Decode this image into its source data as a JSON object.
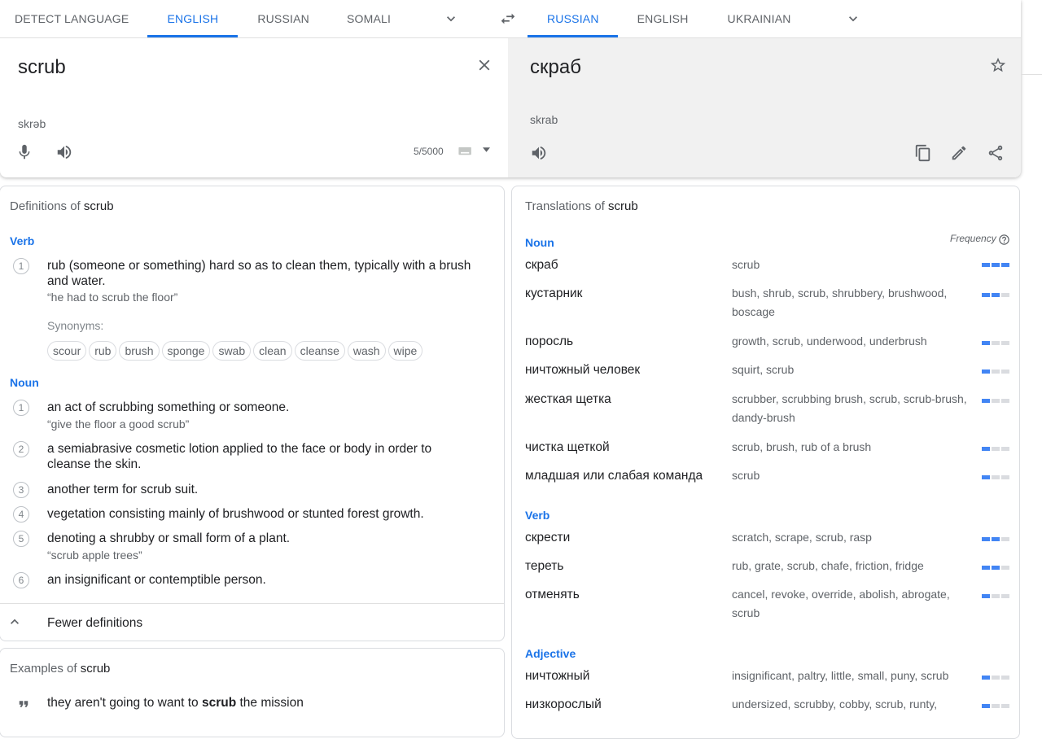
{
  "source_langs": {
    "tabs": [
      {
        "label": "DETECT LANGUAGE",
        "active": false
      },
      {
        "label": "ENGLISH",
        "active": true
      },
      {
        "label": "RUSSIAN",
        "active": false
      },
      {
        "label": "SOMALI",
        "active": false
      }
    ]
  },
  "target_langs": {
    "tabs": [
      {
        "label": "RUSSIAN",
        "active": true
      },
      {
        "label": "ENGLISH",
        "active": false
      },
      {
        "label": "UKRAINIAN",
        "active": false
      }
    ]
  },
  "source": {
    "text": "scrub",
    "transliteration": "skrəb",
    "char_count": "5/5000"
  },
  "target": {
    "text": "скраб",
    "transliteration": "skrab"
  },
  "icons": {
    "accent": "#1a73e8",
    "freq_on": "#4285f4",
    "freq_off": "#dadce0"
  },
  "definitions": {
    "title_prefix": "Definitions of",
    "title_word": "scrub",
    "verb_label": "Verb",
    "verb": [
      {
        "num": "1",
        "text": "rub (someone or something) hard so as to clean them, typically with a brush and water.",
        "example": "“he had to scrub the floor”"
      }
    ],
    "synonyms_label": "Synonyms:",
    "synonyms": [
      "scour",
      "rub",
      "brush",
      "sponge",
      "swab",
      "clean",
      "cleanse",
      "wash",
      "wipe"
    ],
    "noun_label": "Noun",
    "noun": [
      {
        "num": "1",
        "text": "an act of scrubbing something or someone.",
        "example": "“give the floor a good scrub”"
      },
      {
        "num": "2",
        "text": "a semiabrasive cosmetic lotion applied to the face or body in order to cleanse the skin.",
        "example": ""
      },
      {
        "num": "3",
        "text": "another term for scrub suit.",
        "example": ""
      },
      {
        "num": "4",
        "text": "vegetation consisting mainly of brushwood or stunted forest growth.",
        "example": ""
      },
      {
        "num": "5",
        "text": "denoting a shrubby or small form of a plant.",
        "example": "“scrub apple trees”"
      },
      {
        "num": "6",
        "text": "an insignificant or contemptible person.",
        "example": ""
      }
    ],
    "fewer_label": "Fewer definitions"
  },
  "examples": {
    "title_prefix": "Examples of",
    "title_word": "scrub",
    "items": [
      {
        "before": "they aren't going to want to ",
        "bold": "scrub",
        "after": " the mission"
      }
    ]
  },
  "translations": {
    "title_prefix": "Translations of",
    "title_word": "scrub",
    "frequency_label": "Frequency",
    "noun_label": "Noun",
    "noun": [
      {
        "word": "скраб",
        "back": "scrub",
        "freq": 3
      },
      {
        "word": "кустарник",
        "back": "bush, shrub, scrub, shrubbery, brushwood, boscage",
        "freq": 2
      },
      {
        "word": "поросль",
        "back": "growth, scrub, underwood, underbrush",
        "freq": 1
      },
      {
        "word": "ничтожный человек",
        "back": "squirt, scrub",
        "freq": 1
      },
      {
        "word": "жесткая щетка",
        "back": "scrubber, scrubbing brush, scrub, scrub-brush, dandy-brush",
        "freq": 1
      },
      {
        "word": "чистка щеткой",
        "back": "scrub, brush, rub of a brush",
        "freq": 1
      },
      {
        "word": "младшая или слабая команда",
        "back": "scrub",
        "freq": 1
      }
    ],
    "verb_label": "Verb",
    "verb": [
      {
        "word": "скрести",
        "back": "scratch, scrape, scrub, rasp",
        "freq": 2
      },
      {
        "word": "тереть",
        "back": "rub, grate, scrub, chafe, friction, fridge",
        "freq": 2
      },
      {
        "word": "отменять",
        "back": "cancel, revoke, override, abolish, abrogate, scrub",
        "freq": 1
      }
    ],
    "adjective_label": "Adjective",
    "adjective": [
      {
        "word": "ничтожный",
        "back": "insignificant, paltry, little, small, puny, scrub",
        "freq": 1
      },
      {
        "word": "низкорослый",
        "back": "undersized, scrubby, cobby, scrub, runty,",
        "freq": 1
      }
    ]
  }
}
